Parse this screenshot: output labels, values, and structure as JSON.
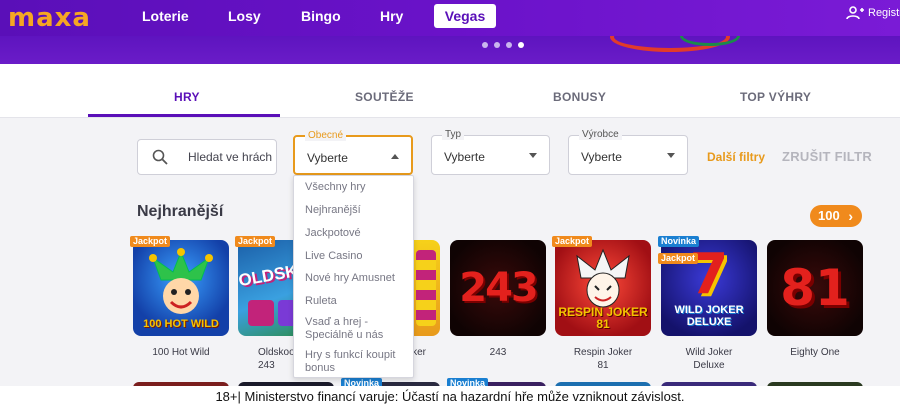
{
  "header": {
    "logo": "maxa",
    "nav": [
      "Loterie",
      "Losy",
      "Bingo",
      "Hry"
    ],
    "nav_active": "Vegas",
    "register": "Registr"
  },
  "tabs": [
    {
      "label": "HRY",
      "active": true
    },
    {
      "label": "SOUTĚŽE",
      "active": false
    },
    {
      "label": "BONUSY",
      "active": false
    },
    {
      "label": "TOP VÝHRY",
      "active": false
    }
  ],
  "filters": {
    "search_placeholder": "Hledat ve hrách",
    "general": {
      "label": "Obecné",
      "value": "Vyberte"
    },
    "type": {
      "label": "Typ",
      "value": "Vyberte"
    },
    "maker": {
      "label": "Výrobce",
      "value": "Vyberte"
    },
    "more": "Další filtry",
    "clear": "ZRUŠIT FILTR"
  },
  "dropdown_options": [
    "Všechny hry",
    "Nejhranější",
    "Jackpotové",
    "Live Casino",
    "Nové hry Amusnet",
    "Ruleta",
    "Vsaď a hrej - Speciálně u nás",
    "Hry s funkcí koupit bonus"
  ],
  "section": {
    "title": "Nejhranější",
    "count": "100"
  },
  "badges": {
    "jackpot": "Jackpot",
    "new": "Novinka"
  },
  "games": [
    {
      "name": "100 Hot Wild",
      "art": "100 HOT WILD"
    },
    {
      "name": "Oldskool 243",
      "art": "OLDSKOOL"
    },
    {
      "name": "…ker",
      "art": ""
    },
    {
      "name": "243",
      "art": "243"
    },
    {
      "name": "Respin Joker 81",
      "art": "RESPIN JOKER 81"
    },
    {
      "name": "Wild Joker Deluxe",
      "art": "WILD JOKER DELUXE"
    },
    {
      "name": "Eighty One",
      "art": "81"
    }
  ],
  "footer": "18+| Ministerstvo financí varuje: Účastí na hazardní hře může vzniknout závislost.",
  "colors": {
    "brand": "#5a0fb8",
    "accent": "#f08a1c"
  }
}
